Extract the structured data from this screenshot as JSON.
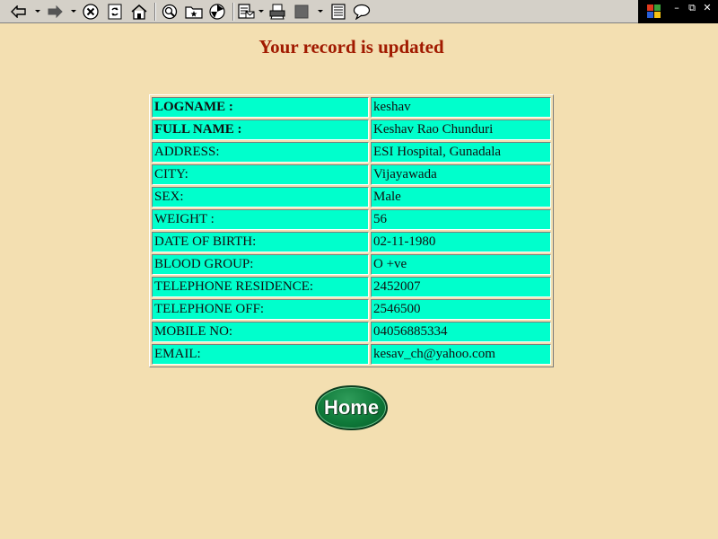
{
  "toolbar": {
    "buttons": [
      "back-icon",
      "forward-icon",
      "stop-icon",
      "refresh-icon",
      "home-icon",
      "search-icon",
      "favorites-icon",
      "history-icon",
      "mail-icon",
      "print-icon",
      "edit-icon",
      "discuss-icon",
      "messenger-icon"
    ]
  },
  "page": {
    "title": "Your record is updated"
  },
  "record": {
    "rows": [
      {
        "label": "LOGNAME :",
        "value": "keshav"
      },
      {
        "label": "FULL NAME :",
        "value": "Keshav Rao Chunduri"
      },
      {
        "label": "ADDRESS:",
        "value": "ESI Hospital, Gunadala"
      },
      {
        "label": "CITY:",
        "value": "Vijayawada"
      },
      {
        "label": "SEX:",
        "value": "Male"
      },
      {
        "label": "WEIGHT :",
        "value": "56"
      },
      {
        "label": "DATE OF BIRTH:",
        "value": "02-11-1980"
      },
      {
        "label": "BLOOD GROUP:",
        "value": "O +ve"
      },
      {
        "label": "TELEPHONE RESIDENCE:",
        "value": "2452007"
      },
      {
        "label": "TELEPHONE OFF:",
        "value": "2546500"
      },
      {
        "label": "MOBILE NO:",
        "value": "04056885334"
      },
      {
        "label": "EMAIL:",
        "value": "kesav_ch@yahoo.com"
      }
    ]
  },
  "home_button": {
    "label": "Home"
  },
  "colors": {
    "page_background": "#f3dfb1",
    "cell_background": "#00ffcc",
    "title_color": "#a11a00",
    "button_green": "#0f7a3a"
  }
}
